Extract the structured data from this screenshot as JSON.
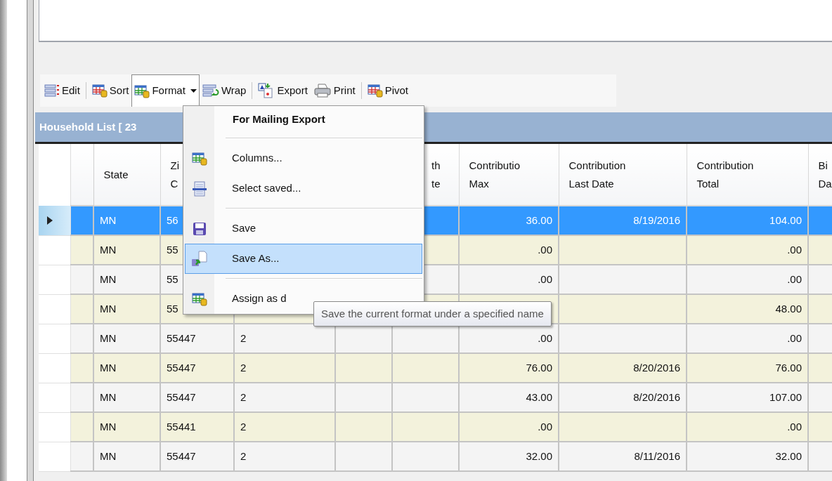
{
  "toolbar": {
    "groups": [
      [
        {
          "label": "Edit",
          "pressed": false,
          "dropdown": false
        }
      ],
      [
        {
          "label": "Sort",
          "pressed": false,
          "dropdown": false
        },
        {
          "label": "Format",
          "pressed": true,
          "dropdown": true
        },
        {
          "label": "Wrap",
          "pressed": false,
          "dropdown": false
        }
      ],
      [
        {
          "label": "Export",
          "pressed": false,
          "dropdown": false
        },
        {
          "label": "Print",
          "pressed": false,
          "dropdown": false
        }
      ],
      [
        {
          "label": "Pivot",
          "pressed": false,
          "dropdown": false
        }
      ]
    ]
  },
  "panel": {
    "title": "Household List [ 23"
  },
  "table": {
    "headers": {
      "state": [
        "State"
      ],
      "column_2": [
        "Zi",
        "C"
      ],
      "column_5": [
        "th",
        "te"
      ],
      "contribution_max": [
        "Contributio",
        "Max"
      ],
      "contribution_last_date": [
        "Contribution",
        "Last Date"
      ],
      "contribution_total": [
        "Contribution",
        "Total"
      ],
      "column_9": [
        "Bi",
        "Da"
      ]
    },
    "rows": [
      {
        "selected": true,
        "state": "MN",
        "column_2": "56",
        "contribution_max": "36.00",
        "contribution_last_date": "8/19/2016",
        "contribution_total": "104.00"
      },
      {
        "selected": false,
        "state": "MN",
        "column_2": "55",
        "contribution_max": ".00",
        "contribution_total": ".00"
      },
      {
        "selected": false,
        "state": "MN",
        "column_2": "55",
        "contribution_max": ".00",
        "contribution_total": ".00"
      },
      {
        "selected": false,
        "state": "MN",
        "column_2": "55",
        "contribution_total": "48.00"
      },
      {
        "selected": false,
        "state": "MN",
        "column_2": "55447",
        "column_3": "2",
        "contribution_max": ".00",
        "contribution_total": ".00"
      },
      {
        "selected": false,
        "state": "MN",
        "column_2": "55447",
        "column_3": "2",
        "contribution_max": "76.00",
        "contribution_last_date": "8/20/2016",
        "contribution_total": "76.00"
      },
      {
        "selected": false,
        "state": "MN",
        "column_2": "55447",
        "column_3": "2",
        "contribution_max": "43.00",
        "contribution_last_date": "8/20/2016",
        "contribution_total": "107.00"
      },
      {
        "selected": false,
        "state": "MN",
        "column_2": "55441",
        "column_3": "2",
        "contribution_max": ".00",
        "contribution_total": ".00"
      },
      {
        "selected": false,
        "state": "MN",
        "column_2": "55447",
        "column_3": "2",
        "contribution_max": "32.00",
        "contribution_last_date": "8/11/2016",
        "contribution_total": "32.00"
      }
    ]
  },
  "menu": {
    "title": "For Mailing Export",
    "groups": [
      [
        {
          "label": "Columns...",
          "selected": false
        },
        {
          "label": "Select saved...",
          "selected": false
        }
      ],
      [
        {
          "label": "Save",
          "selected": false
        },
        {
          "label": "Save As...",
          "selected": true
        }
      ],
      [
        {
          "label": "Assign as d",
          "selected": false
        }
      ]
    ]
  },
  "tooltip": {
    "text": "Save the current format under a specified name"
  }
}
